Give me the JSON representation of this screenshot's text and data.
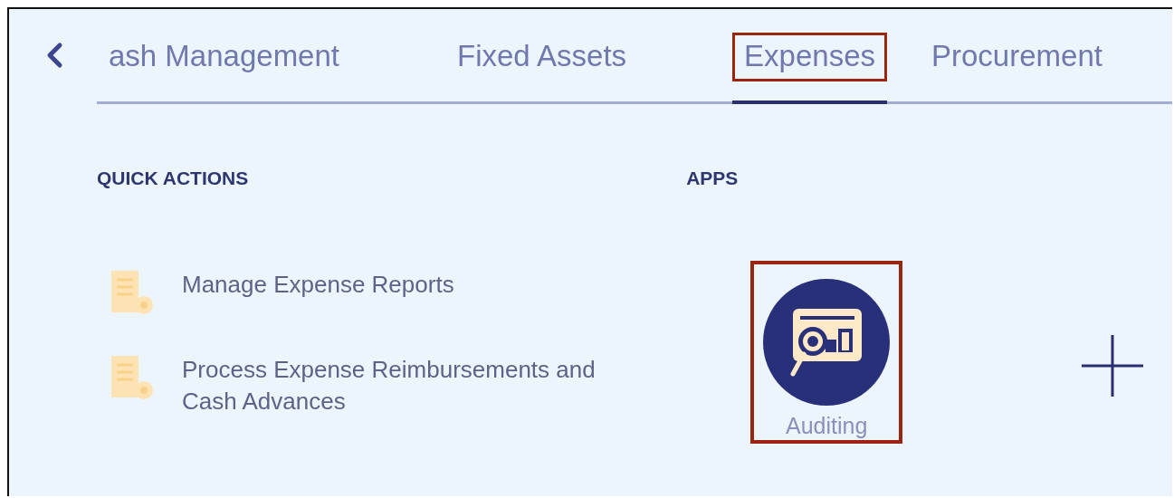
{
  "tabs": [
    {
      "label": "ash Management",
      "selected": false,
      "highlighted": false
    },
    {
      "label": "Fixed Assets",
      "selected": false,
      "highlighted": false
    },
    {
      "label": "Expenses",
      "selected": true,
      "highlighted": true
    },
    {
      "label": "Procurement",
      "selected": false,
      "highlighted": false
    }
  ],
  "quick_actions": {
    "title": "QUICK ACTIONS",
    "items": [
      {
        "label": "Manage Expense Reports"
      },
      {
        "label": "Process Expense Reimbursements and Cash Advances"
      }
    ]
  },
  "apps": {
    "title": "APPS",
    "items": [
      {
        "label": "Auditing",
        "highlighted": true
      }
    ]
  }
}
